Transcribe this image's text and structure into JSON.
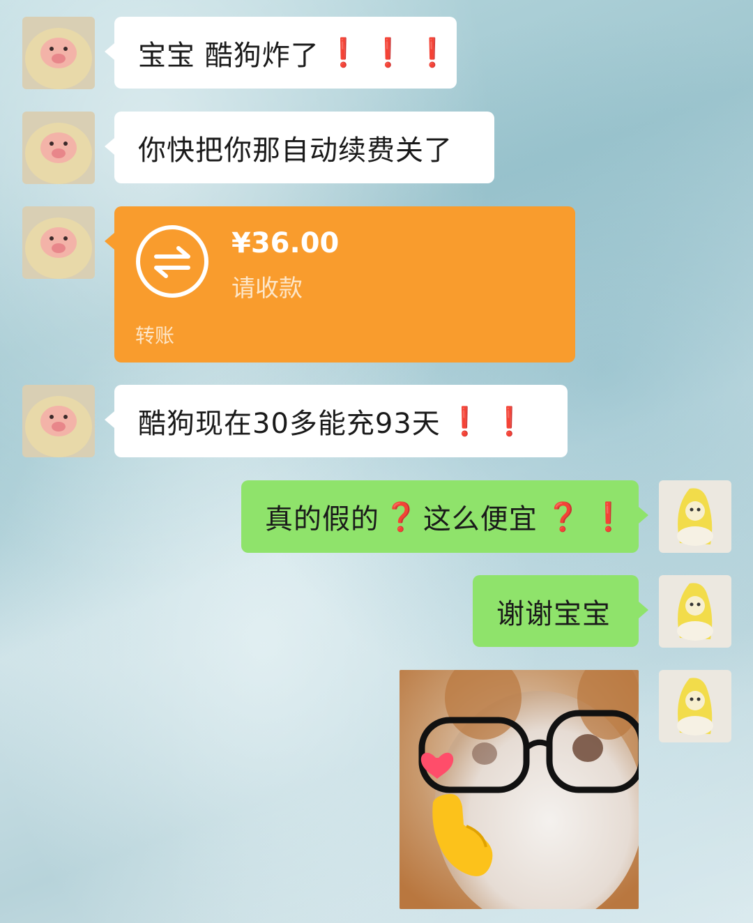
{
  "messages": [
    {
      "side": "left",
      "text": "宝宝 酷狗炸了",
      "emphasis": "❗❗❗"
    },
    {
      "side": "left",
      "text": "你快把你那自动续费关了",
      "emphasis": ""
    },
    {
      "side": "left",
      "type": "transfer",
      "amount": "¥36.00",
      "status": "请收款",
      "label": "转账"
    },
    {
      "side": "left",
      "text": "酷狗现在30多能充93天",
      "emphasis": "❗❗"
    },
    {
      "side": "right",
      "text": "真的假的",
      "q1": "❓",
      "text2": "这么便宜",
      "q2": "❓",
      "bang": "❗"
    },
    {
      "side": "right",
      "text": "谢谢宝宝",
      "emphasis": ""
    },
    {
      "side": "right",
      "type": "sticker",
      "icon": "cat-with-glasses-heart-sticker"
    }
  ],
  "colors": {
    "received_bubble": "#ffffff",
    "sent_bubble": "#8fe36b",
    "transfer_bubble": "#f99c2d",
    "emphasis_red": "#e0202a"
  },
  "icons": {
    "contact_avatar": "pink-pig-plush-avatar",
    "self_avatar": "yellow-banana-plush-avatar",
    "transfer_icon": "exchange-arrows-icon"
  }
}
